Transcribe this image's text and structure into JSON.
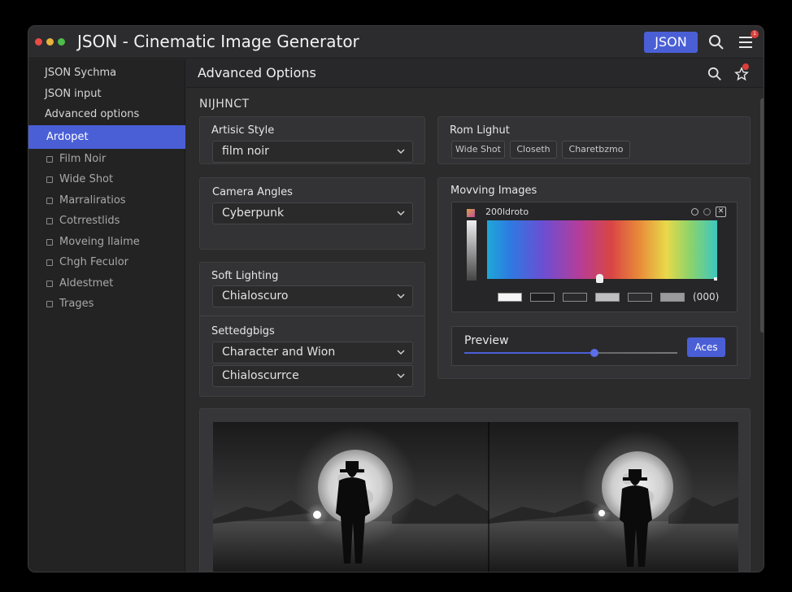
{
  "window": {
    "title": "JSON - Cinematic Image Generator",
    "json_button": "JSON",
    "notification_count": "1"
  },
  "sidebar": {
    "items": [
      {
        "label": "JSON Sychma"
      },
      {
        "label": "JSON input"
      },
      {
        "label": "Advanced options"
      },
      {
        "label": "Ardopet"
      }
    ],
    "sub_items": [
      {
        "label": "Film Noir",
        "icon": "film-icon"
      },
      {
        "label": "Wide Shot",
        "icon": "shot-icon"
      },
      {
        "label": "Marraliratios",
        "icon": "grid-icon"
      },
      {
        "label": "Cotrrestlids",
        "icon": "grid-icon"
      },
      {
        "label": "Moveing Ilaime",
        "icon": "grid-icon"
      },
      {
        "label": "Chgh Feculor",
        "icon": "grid-icon"
      },
      {
        "label": "Aldestmet",
        "icon": "grid-icon"
      },
      {
        "label": "Trages",
        "icon": "image-icon"
      }
    ]
  },
  "main": {
    "title": "Advanced Options",
    "section_label": "NIJHNCT",
    "artistic_style": {
      "label": "Artisic Style",
      "value": "film noir"
    },
    "camera_angles": {
      "label": "Camera Angles",
      "value": "Cyberpunk"
    },
    "soft_lighting": {
      "label": "Soft Lighting",
      "value": "Chialoscuro"
    },
    "settings": {
      "label": "Settedgbigs",
      "value1": "Character and Wion",
      "value2": "Chialoscurrce"
    },
    "rom_lighut": {
      "label": "Rom Lighut",
      "chips": [
        "Wide Shot",
        "Closeth",
        "Charetbzmo"
      ]
    },
    "moving_images": {
      "label": "Movving Images",
      "gradient_label": "200ldroto",
      "readout": "(000)"
    },
    "preview": {
      "label": "Preview",
      "apply_button": "Aces",
      "slider_fraction": 0.61
    }
  },
  "colors": {
    "accent": "#4a5fd6",
    "badge": "#d9403a"
  }
}
